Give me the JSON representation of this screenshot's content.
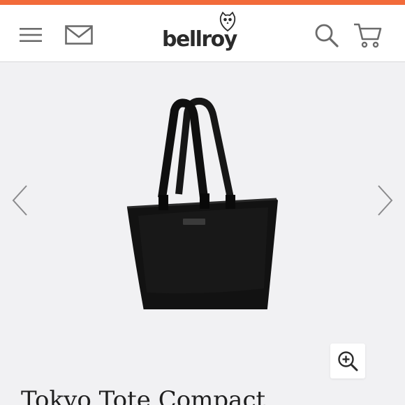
{
  "colors": {
    "accent_bar": "#f26b3a",
    "icon": "#6b6b6b",
    "gallery_bg": "#f1f1f3"
  },
  "header": {
    "logo_text": "bellroy",
    "icons": {
      "menu": "hamburger-menu-icon",
      "mail": "mail-icon",
      "search": "search-icon",
      "cart": "cart-icon"
    }
  },
  "gallery": {
    "prev_icon": "chevron-left-icon",
    "next_icon": "chevron-right-icon",
    "zoom_icon": "zoom-in-icon"
  },
  "product": {
    "title": "Tokyo Tote Compact"
  }
}
